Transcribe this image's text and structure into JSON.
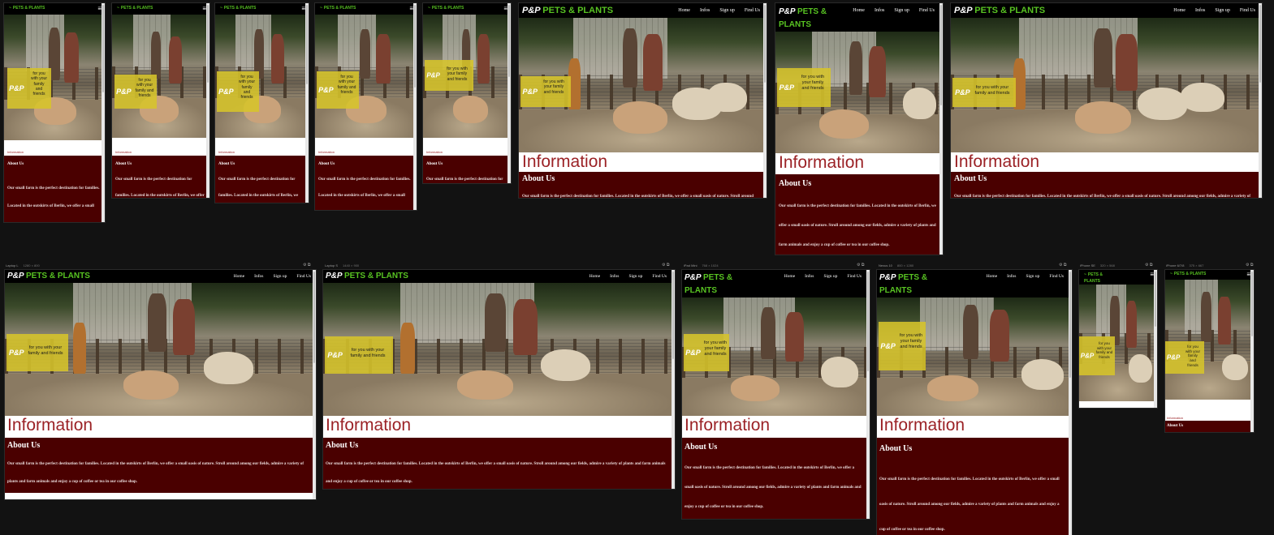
{
  "brand": {
    "logo": "P&P",
    "name": "PETS & PLANTS",
    "logo_combined_small": "PETS & PLANTS",
    "name_line1": "PETS &",
    "name_line2": "PLANTS"
  },
  "nav": [
    "Home",
    "Infos",
    "Sign up",
    "Find Us"
  ],
  "badge": {
    "pp": "P&P",
    "tagline": "for you with your family and friends",
    "tag_lines_narrow": [
      "for you",
      "with your",
      "family",
      "and",
      "friends"
    ],
    "tag_lines_mid": [
      "for you",
      "with your",
      "family and",
      "friends"
    ],
    "tag_lines_wide": [
      "for you with your",
      "family and friends"
    ],
    "tag_lines_3": [
      "for you with",
      "your family",
      "and friends"
    ]
  },
  "section": {
    "information": "Information",
    "about_title": "About Us",
    "about_text": "Our small farm is the perfect destination for families. Located in the outskirts of Berlin, we offer a small oasis of nature. Stroll around among our fields, admire a variety of plants and farm animals and enjoy a cup of coffee or tea in our coffee shop."
  },
  "captions": [
    {
      "name": "Laptop L",
      "size": "1280 × 800"
    },
    {
      "name": "Laptop S",
      "size": "1440 × 900"
    },
    {
      "name": "iPad Mini",
      "size": "768 × 1024"
    },
    {
      "name": "Nexus 10",
      "size": "800 × 1280"
    },
    {
      "name": "iPhone SE",
      "size": "320 × 568"
    },
    {
      "name": "iPhone 6/7/8",
      "size": "375 × 667"
    }
  ],
  "colors": {
    "background": "#121212",
    "nav": "#000000",
    "brand_green": "#58c322",
    "badge_yellow": "#d6c42a",
    "info_red": "#9b2226",
    "about_bg": "#4a0000"
  },
  "icons": {
    "menu": "hamburger-menu-icon"
  }
}
